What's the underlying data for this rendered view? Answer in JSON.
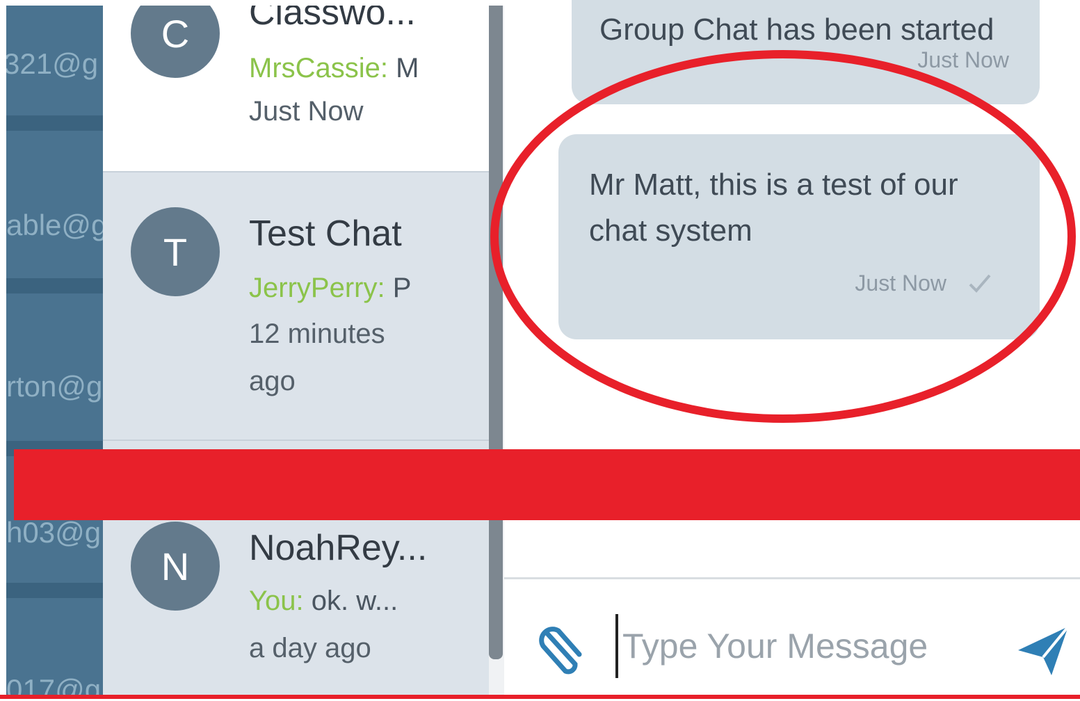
{
  "sidebar": {
    "emails": [
      {
        "text": "321@g"
      },
      {
        "text": "able@g"
      },
      {
        "text": "rton@g"
      },
      {
        "text": "h03@g"
      },
      {
        "text": "017@g"
      }
    ]
  },
  "conversations": [
    {
      "avatar": "C",
      "title": "Classwo...",
      "sender": "MrsCassie:",
      "preview": " M",
      "time": "Just Now"
    },
    {
      "avatar": "T",
      "title": "Test Chat",
      "sender": "JerryPerry:",
      "preview": " P",
      "time": "12 minutes ago"
    },
    {
      "avatar": "N",
      "title": "NoahRey...",
      "sender": "You:",
      "preview": " ok. w...",
      "time": "a day ago"
    }
  ],
  "messages": [
    {
      "text": "Group Chat has been started",
      "time": "Just Now"
    },
    {
      "text": "Mr Matt, this is a test of our chat system",
      "time": "Just Now"
    }
  ],
  "composer": {
    "placeholder": "Type Your Message",
    "attach_icon": "paperclip-icon",
    "send_icon": "paper-plane-icon"
  },
  "colors": {
    "sidebar": "#4a7390",
    "sender_green": "#8bc34a",
    "bubble": "#d3dde4",
    "send_blue": "#2f7fb5",
    "annotation_red": "#e8202a"
  }
}
